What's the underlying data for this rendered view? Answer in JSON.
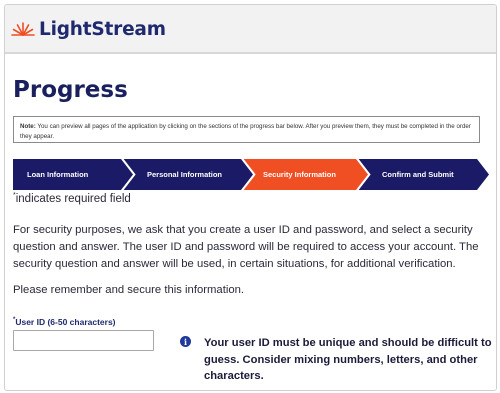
{
  "brand": {
    "name": "LightStream",
    "accent": "#f04e23",
    "navy": "#1a1a66"
  },
  "page": {
    "title": "Progress"
  },
  "note": {
    "label": "Note:",
    "text": "You can preview all pages of the application by clicking on the sections of the progress bar below. After you preview them, they must be completed in the order they appear."
  },
  "progress": {
    "steps": [
      {
        "label": "Loan Information",
        "state": "default"
      },
      {
        "label": "Personal Information",
        "state": "default"
      },
      {
        "label": "Security Information",
        "state": "active"
      },
      {
        "label": "Confirm and Submit",
        "state": "default"
      }
    ],
    "colors": {
      "default": "#1a1a66",
      "active": "#f04e23"
    }
  },
  "form": {
    "required_marker": "*",
    "required_text": "indicates required field",
    "intro": "For security purposes, we ask that you create a user ID and password, and select a security question and answer. The user ID and password will be required to access your account. The security question and answer will be used, in certain situations, for additional verification.",
    "remember": "Please remember and secure this information.",
    "userid_marker": "*",
    "userid_label": "User ID (6-50 characters)",
    "userid_value": "",
    "info_icon": "info-icon",
    "tip": "Your user ID must be unique and should be difficult to guess. Consider mixing numbers, letters, and other characters."
  }
}
